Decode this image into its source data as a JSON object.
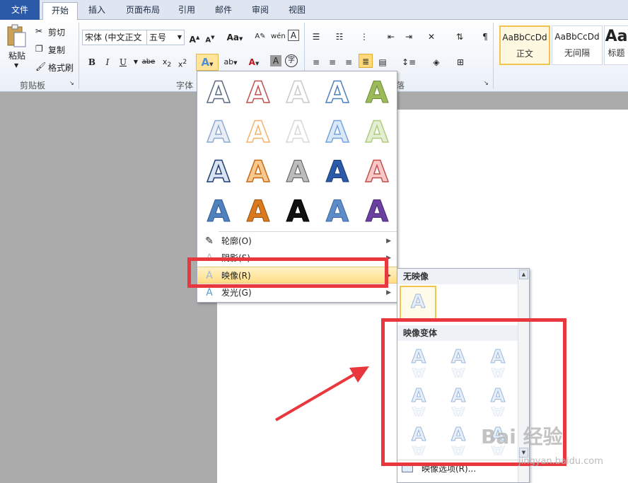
{
  "tabs": [
    "文件",
    "开始",
    "插入",
    "页面布局",
    "引用",
    "邮件",
    "审阅",
    "视图"
  ],
  "active_tab": "开始",
  "clipboard": {
    "paste_label": "粘贴",
    "cut_label": "剪切",
    "copy_label": "复制",
    "format_painter_label": "格式刷",
    "group_label": "剪贴板"
  },
  "font": {
    "font_name": "宋体 (中文正文",
    "font_size": "五号",
    "group_label": "字体"
  },
  "paragraph": {
    "group_label_partial": "落"
  },
  "styles": [
    {
      "sample": "AaBbCcDd",
      "name": "正文"
    },
    {
      "sample": "AaBbCcDd",
      "name": "无间隔"
    },
    {
      "sample": "Aa",
      "name": "标题"
    }
  ],
  "effects_menu": {
    "items": [
      {
        "label": "轮廓(O)",
        "icon": "outline-pen-icon"
      },
      {
        "label": "阴影(S)",
        "icon": "shadow-icon"
      },
      {
        "label": "映像(R)",
        "icon": "reflection-icon"
      },
      {
        "label": "发光(G)",
        "icon": "glow-icon"
      }
    ]
  },
  "reflection_menu": {
    "no_reflection_header": "无映像",
    "variants_header": "映像变体",
    "options_label": "映像选项(R)..."
  },
  "watermark": {
    "logo_text": "Bai 经验",
    "url": "jingyan.baidu.com"
  },
  "colors": {
    "file_tab": "#2a5aa8",
    "highlight": "#ffdd84",
    "annotation_red": "#e8383d"
  }
}
